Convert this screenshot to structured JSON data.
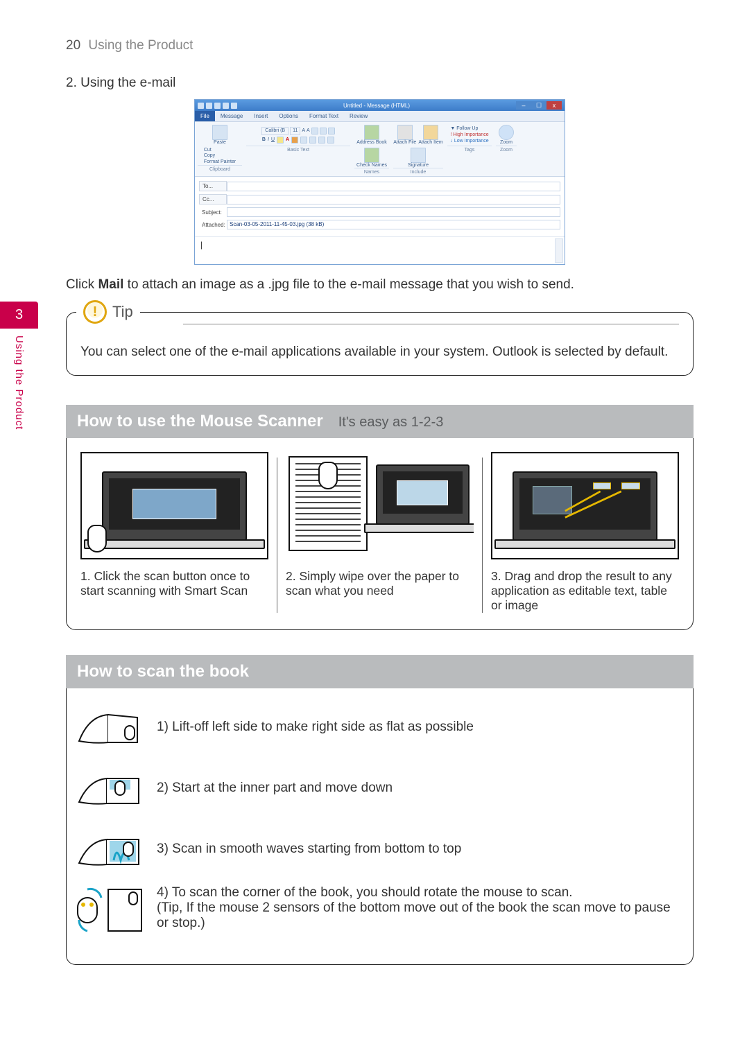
{
  "header": {
    "page_num": "20",
    "page_title": "Using the Product"
  },
  "step2_title": "2.  Using the e-mail",
  "outlook": {
    "title": "Untitled - Message (HTML)",
    "tabs": {
      "file": "File",
      "message": "Message",
      "insert": "Insert",
      "options": "Options",
      "format": "Format Text",
      "review": "Review"
    },
    "clipboard": {
      "cut": "Cut",
      "copy": "Copy",
      "fmt": "Format Painter",
      "paste": "Paste",
      "group": "Clipboard"
    },
    "basic": {
      "font": "Calibri (B",
      "size": "11",
      "group": "Basic Text"
    },
    "names": {
      "addr": "Address Book",
      "check": "Check Names",
      "group": "Names"
    },
    "include": {
      "file": "Attach File",
      "item": "Attach Item",
      "sig": "Signature",
      "group": "Include"
    },
    "tags": {
      "follow": "Follow Up",
      "high": "High Importance",
      "low": "Low Importance",
      "group": "Tags"
    },
    "zoom": {
      "label": "Zoom",
      "group": "Zoom"
    },
    "fields": {
      "to": "To...",
      "cc": "Cc...",
      "subject": "Subject:",
      "attached": "Attached:",
      "attachment": "Scan-03-05-2011-11-45-03.jpg (38 kB)"
    },
    "body_cursor": "|"
  },
  "mail_text_pre": "Click ",
  "mail_text_bold": "Mail",
  "mail_text_post": " to attach an image as a .jpg file to the e-mail message that you wish to send.",
  "sidebar": {
    "num": "3",
    "label": "Using the Product"
  },
  "tip": {
    "label": "Tip",
    "text": "You can select one of the e-mail applications available in your system. Outlook is selected by default."
  },
  "mouse_section": {
    "title": "How to use the Mouse Scanner",
    "subtitle": "It's easy as 1-2-3",
    "steps": [
      "1. Click the scan button once to start scanning with Smart Scan",
      "2. Simply wipe over the paper to scan what you need",
      "3. Drag and drop the result to any application as editable text, table or image"
    ]
  },
  "book_section": {
    "title": "How to scan the book",
    "rows": [
      "1) Lift-off left side to make right side as flat as possible",
      "2) Start at the inner part and move down",
      "3) Scan in smooth waves starting from bottom to top"
    ],
    "row4_line1": "4) To scan the corner of the book, you should rotate the mouse to scan.",
    "row4_line2": "(Tip, If the mouse 2 sensors of the bottom move out of the book the scan move to pause or stop.)"
  }
}
